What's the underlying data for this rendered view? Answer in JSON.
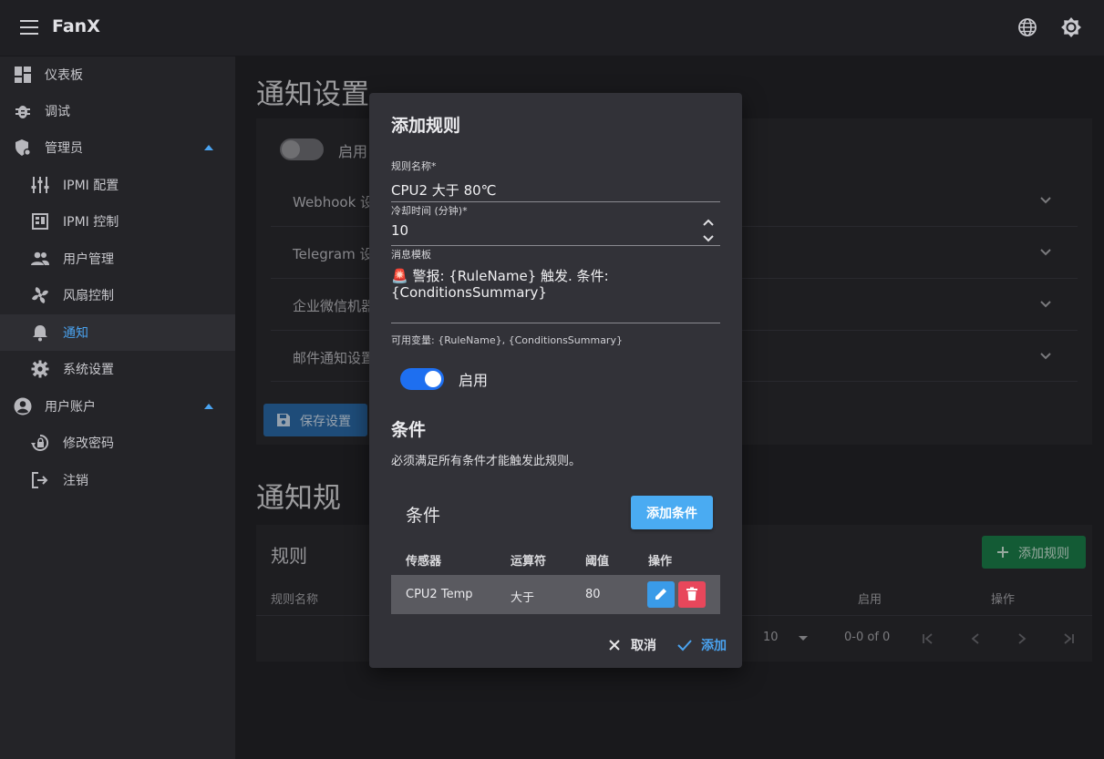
{
  "app": {
    "brand": "FanX"
  },
  "sidebar": {
    "items": [
      {
        "label": "仪表板",
        "icon": "dashboard-icon"
      },
      {
        "label": "调试",
        "icon": "bug-icon"
      },
      {
        "label": "管理员",
        "icon": "admin-shield-icon"
      },
      {
        "label": "IPMI 配置",
        "icon": "sliders-icon"
      },
      {
        "label": "IPMI 控制",
        "icon": "control-icon"
      },
      {
        "label": "用户管理",
        "icon": "users-icon"
      },
      {
        "label": "风扇控制",
        "icon": "fan-icon"
      },
      {
        "label": "通知",
        "icon": "bell-icon"
      },
      {
        "label": "系统设置",
        "icon": "gear-icon"
      },
      {
        "label": "用户账户",
        "icon": "account-icon"
      },
      {
        "label": "修改密码",
        "icon": "lock-reset-icon"
      },
      {
        "label": "注销",
        "icon": "logout-icon"
      }
    ]
  },
  "page": {
    "title": "通知设置",
    "enable_label": "启用",
    "accordions": [
      "Webhook 设",
      "Telegram 设",
      "企业微信机器",
      "邮件通知设置"
    ],
    "save_button": "保存设置",
    "rules_title": "通知规",
    "rules_card_title": "规则",
    "add_rule_button": "添加规则",
    "rules_table_headers": {
      "name": "规则名称",
      "enabled": "启用",
      "actions": "操作"
    },
    "pagination": {
      "per_page": "10",
      "range": "0-0 of 0"
    }
  },
  "modal": {
    "title": "添加规则",
    "rule_name_label": "规则名称*",
    "rule_name_value": "CPU2 大于 80℃",
    "cooldown_label": "冷却时间 (分钟)*",
    "cooldown_value": "10",
    "template_label": "消息模板",
    "template_line1": "🚨 警报: {RuleName} 触发. 条件:",
    "template_line2": "{ConditionsSummary}",
    "vars_hint": "可用变量: {RuleName}, {ConditionsSummary}",
    "enable_label": "启用",
    "conditions_title": "条件",
    "conditions_desc": "必须满足所有条件才能触发此规则。",
    "conditions_box_title": "条件",
    "add_condition_button": "添加条件",
    "table_headers": [
      "传感器",
      "运算符",
      "阈值",
      "操作"
    ],
    "rows": [
      {
        "sensor": "CPU2 Temp",
        "operator": "大于",
        "threshold": "80"
      }
    ],
    "cancel_button": "取消",
    "add_button": "添加"
  }
}
